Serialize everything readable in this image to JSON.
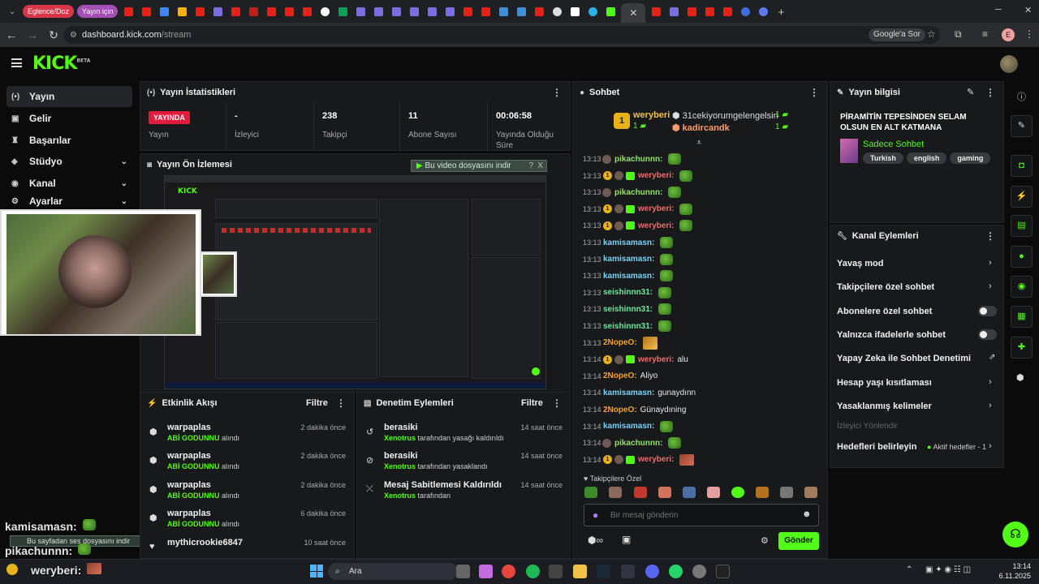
{
  "browser": {
    "tab_groups": [
      "Eglence/Doz",
      "Yayın için"
    ],
    "url_host": "dashboard.kick.com",
    "url_path": "/stream",
    "google_sor": "Google'a Sor",
    "profile_initial": "E"
  },
  "kick": {
    "logo": "KICK",
    "logo_badge": "BETA"
  },
  "sidebar": {
    "items": [
      {
        "label": "Yayın",
        "icon": "broadcast-icon"
      },
      {
        "label": "Gelir",
        "icon": "money-icon"
      },
      {
        "label": "Başarılar",
        "icon": "trophy-icon"
      },
      {
        "label": "Stüdyo",
        "icon": "studio-icon"
      },
      {
        "label": "Kanal",
        "icon": "channel-icon"
      },
      {
        "label": "Ayarlar",
        "icon": "settings-icon"
      }
    ]
  },
  "stats": {
    "title": "Yayın İstatistikleri",
    "status": "YAYINDA",
    "status_label": "Yayın",
    "viewers": "-",
    "viewers_label": "İzleyici",
    "followers": "238",
    "followers_label": "Takipçi",
    "subs": "11",
    "subs_label": "Abone Sayısı",
    "duration": "00:06:58",
    "duration_label": "Yayında Olduğu Süre"
  },
  "preview": {
    "title": "Yayın Ön İzlemesi",
    "download_bar": "Bu video dosyasını indir",
    "download_q": "?",
    "download_x": "X"
  },
  "events": {
    "title": "Etkinlik Akışı",
    "filter": "Filtre",
    "items": [
      {
        "name": "warpaplas",
        "sub": "ABİ GODUNNU",
        "suffix": "alındı",
        "time": "2 dakika önce"
      },
      {
        "name": "warpaplas",
        "sub": "ABİ GODUNNU",
        "suffix": "alındı",
        "time": "2 dakika önce"
      },
      {
        "name": "warpaplas",
        "sub": "ABİ GODUNNU",
        "suffix": "alındı",
        "time": "2 dakika önce"
      },
      {
        "name": "warpaplas",
        "sub": "ABİ GODUNNU",
        "suffix": "alındı",
        "time": "6 dakika önce"
      },
      {
        "name": "mythicrookie6847",
        "sub": "",
        "suffix": "",
        "time": "10 saat önce"
      }
    ]
  },
  "moderation": {
    "title": "Denetim Eylemleri",
    "filter": "Filtre",
    "items": [
      {
        "name": "berasiki",
        "by": "Xenotrus",
        "action": "tarafından yasağı kaldırıldı",
        "time": "14 saat önce"
      },
      {
        "name": "berasiki",
        "by": "Xenotrus",
        "action": "tarafından yasaklandı",
        "time": "14 saat önce"
      },
      {
        "name": "Mesaj Sabitlemesi Kaldırıldı",
        "by": "Xenotrus",
        "action": "tarafından",
        "time": "14 saat önce"
      }
    ]
  },
  "chat": {
    "title": "Sohbet",
    "leaders": [
      {
        "rank": "1",
        "name": "weryberi",
        "badge": "1"
      },
      {
        "name": "31cekiyorumgelengelsin",
        "badge": "1"
      },
      {
        "name": "kadircandk",
        "badge": "1"
      }
    ],
    "messages": [
      {
        "t": "13:13",
        "u": "pikachunnn:",
        "c": "#8fe36a",
        "b": "s",
        "m": "",
        "e": "g"
      },
      {
        "t": "13:13",
        "u": "weryberi:",
        "c": "#f06d6d",
        "b": "1s3",
        "m": "",
        "e": "g"
      },
      {
        "t": "13:13",
        "u": "pikachunnn:",
        "c": "#8fe36a",
        "b": "s",
        "m": "",
        "e": "g"
      },
      {
        "t": "13:13",
        "u": "weryberi:",
        "c": "#f06d6d",
        "b": "1s3",
        "m": "",
        "e": "g"
      },
      {
        "t": "13:13",
        "u": "weryberi:",
        "c": "#f06d6d",
        "b": "1s3",
        "m": "",
        "e": "g"
      },
      {
        "t": "13:13",
        "u": "kamisamasn:",
        "c": "#7bd1f2",
        "b": "",
        "m": "",
        "e": "g"
      },
      {
        "t": "13:13",
        "u": "kamisamasn:",
        "c": "#7bd1f2",
        "b": "",
        "m": "",
        "e": "g"
      },
      {
        "t": "13:13",
        "u": "kamisamasn:",
        "c": "#7bd1f2",
        "b": "",
        "m": "",
        "e": "g"
      },
      {
        "t": "13:13",
        "u": "seishinnn31:",
        "c": "#6fe6a0",
        "b": "",
        "m": "",
        "e": "g"
      },
      {
        "t": "13:13",
        "u": "seishinnn31:",
        "c": "#6fe6a0",
        "b": "",
        "m": "",
        "e": "g"
      },
      {
        "t": "13:13",
        "u": "seishinnn31:",
        "c": "#6fe6a0",
        "b": "",
        "m": "",
        "e": "g"
      },
      {
        "t": "13:13",
        "u": "2NopeO:",
        "c": "#f2a33a",
        "b": "",
        "m": "",
        "e": "y"
      },
      {
        "t": "13:14",
        "u": "weryberi:",
        "c": "#f06d6d",
        "b": "1s3",
        "m": "alu",
        "e": ""
      },
      {
        "t": "13:14",
        "u": "2NopeO:",
        "c": "#f2a33a",
        "b": "",
        "m": "Aliyo",
        "e": ""
      },
      {
        "t": "13:14",
        "u": "kamisamasn:",
        "c": "#7bd1f2",
        "b": "",
        "m": "gunaydınn",
        "e": ""
      },
      {
        "t": "13:14",
        "u": "2NopeO:",
        "c": "#f2a33a",
        "b": "",
        "m": "Günaydıning",
        "e": ""
      },
      {
        "t": "13:14",
        "u": "kamisamasn:",
        "c": "#7bd1f2",
        "b": "",
        "m": "",
        "e": "g"
      },
      {
        "t": "13:14",
        "u": "pikachunnn:",
        "c": "#8fe36a",
        "b": "s",
        "m": "",
        "e": "g"
      },
      {
        "t": "13:14",
        "u": "weryberi:",
        "c": "#f06d6d",
        "b": "1s3",
        "m": "",
        "e": "r"
      }
    ],
    "followers_only": "Takipçilere Özel",
    "input_placeholder": "Bir mesaj gönderin",
    "send": "Gönder"
  },
  "info": {
    "title": "Yayın bilgisi",
    "stream_title": "PİRAMİTİN TEPESİNDEN SELAM OLSUN EN ALT KATMANA",
    "category": "Sadece Sohbet",
    "tags": [
      "Turkish",
      "english",
      "gaming"
    ]
  },
  "actions": {
    "title": "Kanal Eylemleri",
    "items": [
      {
        "label": "Yavaş mod",
        "kind": "chev"
      },
      {
        "label": "Takipçilere özel sohbet",
        "kind": "chev"
      },
      {
        "label": "Abonelere özel sohbet",
        "kind": "toggle"
      },
      {
        "label": "Yalnızca ifadelerle sohbet",
        "kind": "toggle"
      },
      {
        "label": "Yapay Zeka ile Sohbet Denetimi",
        "kind": "ext"
      },
      {
        "label": "Hesap yaşı kısıtlaması",
        "kind": "chev"
      },
      {
        "label": "Yasaklanmış kelimeler",
        "kind": "chev"
      }
    ],
    "redirect": "İzleyici Yönlendir",
    "goals": "Hedefleri belirleyin",
    "goals_status": "Aktif hedefler - 1"
  },
  "overlay": {
    "line1": "kamisamasn:",
    "line2": "pikachunnn:",
    "line3": "weryberi:",
    "audio_bar": "Bu sayfadan ses dosyasını indir"
  },
  "taskbar": {
    "search": "Ara",
    "time": "13:14",
    "date": "6.11.2025"
  }
}
